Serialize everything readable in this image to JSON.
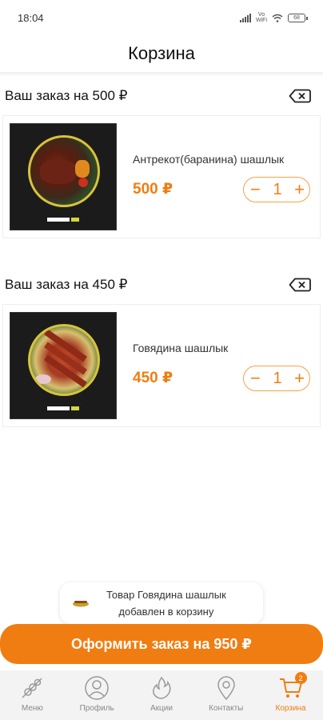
{
  "status_bar": {
    "time": "18:04",
    "battery": "68"
  },
  "header": {
    "title": "Корзина"
  },
  "orders": [
    {
      "title": "Ваш заказ на 500 ₽",
      "item": {
        "name": "Антрекот(баранина) шашлык",
        "price": "500 ₽",
        "quantity": "1"
      }
    },
    {
      "title": "Ваш заказ на 450 ₽",
      "item": {
        "name": "Говядина шашлык",
        "price": "450 ₽",
        "quantity": "1"
      }
    }
  ],
  "toast": {
    "line1": "Товар Говядина шашлык",
    "line2": "добавлен в корзину"
  },
  "checkout": {
    "label": "Оформить заказ на 950 ₽"
  },
  "tabbar": {
    "menu": "Меню",
    "profile": "Профиль",
    "promotions": "Акции",
    "contacts": "Контакты",
    "cart": "Корзина",
    "cart_badge": "2"
  },
  "colors": {
    "accent": "#f07d12",
    "accent_border": "#f5a347"
  },
  "icons": [
    "close-backspace-icon",
    "skewer-icon",
    "user-icon",
    "fire-icon",
    "location-pin-icon",
    "cart-icon"
  ]
}
